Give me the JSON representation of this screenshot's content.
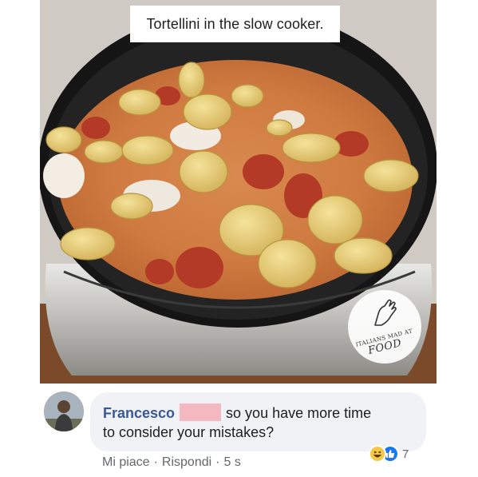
{
  "post": {
    "caption": "Tortellini in the slow cooker.",
    "watermark": {
      "line1": "ITALIANS MAD AT",
      "line2": "FOOD"
    }
  },
  "comment": {
    "author": "Francesco",
    "text_line1": "so you have more time",
    "text_line2": "to consider your mistakes?",
    "reaction_count": "7",
    "reactions": [
      "haha-icon",
      "like-icon"
    ],
    "actions": {
      "like": "Mi piace",
      "reply": "Rispondi",
      "time": "5 s",
      "separator": "·"
    }
  },
  "colors": {
    "author": "#385898",
    "bubble": "#f0f2f5",
    "redaction": "#f4b8c0",
    "like": "#1877f2"
  }
}
